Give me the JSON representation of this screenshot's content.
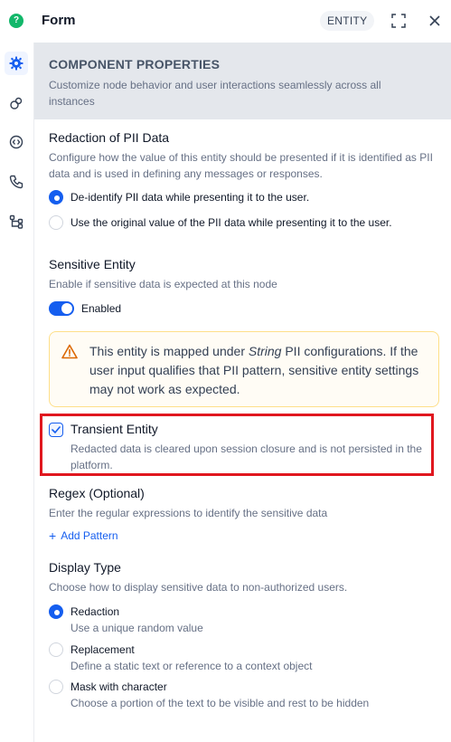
{
  "header": {
    "title": "Form",
    "badge": "ENTITY",
    "icons": [
      "chat-logo-icon",
      "expand-icon",
      "close-icon"
    ]
  },
  "sidebar": {
    "items": [
      {
        "icon": "gear-icon",
        "active": true
      },
      {
        "icon": "link-icon",
        "active": false
      },
      {
        "icon": "code-icon",
        "active": false
      },
      {
        "icon": "phone-icon",
        "active": false
      },
      {
        "icon": "flow-icon",
        "active": false
      }
    ]
  },
  "banner": {
    "title": "COMPONENT PROPERTIES",
    "description": "Customize node behavior and user interactions seamlessly across all instances"
  },
  "redaction": {
    "title": "Redaction of PII Data",
    "description": "Configure how the value of this entity should be presented if it is identified as PII data and is used in defining any messages or responses.",
    "options": [
      {
        "label": "De-identify PII data while presenting it to the user.",
        "selected": true
      },
      {
        "label": "Use the original value of the PII data while presenting it to the user.",
        "selected": false
      }
    ]
  },
  "sensitive": {
    "title": "Sensitive Entity",
    "description": "Enable if sensitive data is expected at this node",
    "toggle_label": "Enabled",
    "enabled": true
  },
  "warning": {
    "text_before": "This entity is mapped under ",
    "text_italic": "String",
    "text_after": " PII configurations. If the user input qualifies that PII pattern, sensitive entity settings may not work as expected."
  },
  "transient": {
    "title": "Transient Entity",
    "description": "Redacted data is cleared upon session closure and is not persisted in the platform.",
    "checked": true
  },
  "regex": {
    "title": "Regex (Optional)",
    "description": "Enter the regular expressions to identify the sensitive data",
    "add_label": "Add Pattern"
  },
  "display_type": {
    "title": "Display Type",
    "description": "Choose how to display sensitive data to non-authorized users.",
    "options": [
      {
        "label": "Redaction",
        "sub": "Use a unique random value",
        "selected": true
      },
      {
        "label": "Replacement",
        "sub": "Define a static text or reference to a context object",
        "selected": false
      },
      {
        "label": "Mask with character",
        "sub": "Choose a portion of the text to be visible and rest to be hidden",
        "selected": false
      }
    ]
  },
  "colors": {
    "primary": "#155eef",
    "highlight": "#e0171f",
    "warning_border": "#fedf89",
    "logo": "#12b76a"
  }
}
